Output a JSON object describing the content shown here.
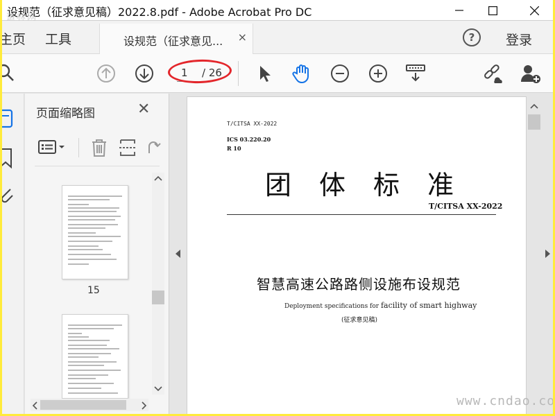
{
  "window": {
    "title": "设规范（征求意见稿）2022.8.pdf - Adobe Acrobat Pro DC",
    "watermark_top": "道林网"
  },
  "tabs": {
    "home": "主页",
    "tools": "工具",
    "document_tab": "设规范（征求意见...",
    "document_close": "×",
    "help": "?",
    "login": "登录"
  },
  "toolbar": {
    "current_page": "1",
    "total_pages": "/ 26"
  },
  "thumbnails_panel": {
    "title": "页面缩略图",
    "close": "✕",
    "thumbnail_page_label": "15"
  },
  "document": {
    "standard_code_header": "T/CITSA XX-2022",
    "ics": "ICS 03.220.20",
    "r": "R 10",
    "main_title": "团体标准",
    "standard_code": "T/CITSA  XX-2022",
    "subtitle": "智慧高速公路路侧设施布设规范",
    "english_small": "Deployment specifications for ",
    "english_big": "facility of smart highway",
    "note": "(征求意见稿)"
  },
  "footer_watermark": "www.cndao.com",
  "colors": {
    "highlight_ellipse": "#e3262b",
    "hand_tool_active": "#1473e6",
    "screenshot_border": "#ffeb3b"
  }
}
